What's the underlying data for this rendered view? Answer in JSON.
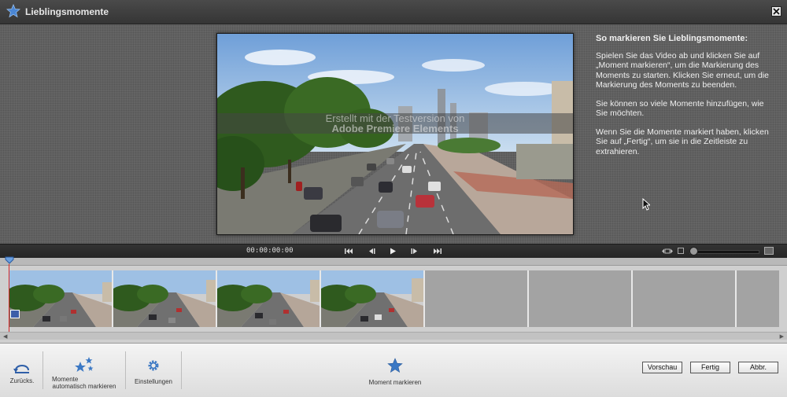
{
  "window": {
    "title": "Lieblingsmomente",
    "close_label": "Close"
  },
  "instructions": {
    "heading": "So markieren Sie Lieblingsmomente:",
    "p1": "Spielen Sie das Video ab und klicken Sie auf „Moment markieren“, um die Markierung des Moments zu starten. Klicken Sie erneut, um die Markierung des Moments zu beenden.",
    "p2": "Sie können so viele Momente hinzufügen, wie Sie möchten.",
    "p3": "Wenn Sie die Momente markiert haben, klicken Sie auf „Fertig“, um sie in die Zeitleiste zu extrahieren."
  },
  "video": {
    "watermark_line1": "Erstellt mit der Testversion von",
    "watermark_line2": "Adobe Premiere Elements"
  },
  "transport": {
    "timecode": "00:00:00:00",
    "icons": [
      "go-to-start-icon",
      "step-back-icon",
      "play-icon",
      "step-forward-icon",
      "go-to-end-icon"
    ]
  },
  "timeline": {
    "thumbnails": 4,
    "empty_slots": 4
  },
  "toolbar": {
    "undo_label": "Zurücks.",
    "auto_mark_label_1": "Momente",
    "auto_mark_label_2": "automatisch markieren",
    "settings_label": "Einstellungen",
    "mark_moment_label": "Moment markieren",
    "preview_label": "Vorschau",
    "done_label": "Fertig",
    "cancel_label": "Abbr."
  },
  "colors": {
    "accent_star": "#3b78c4",
    "titlebar": "#3c3c3c",
    "playhead": "#d62828"
  }
}
